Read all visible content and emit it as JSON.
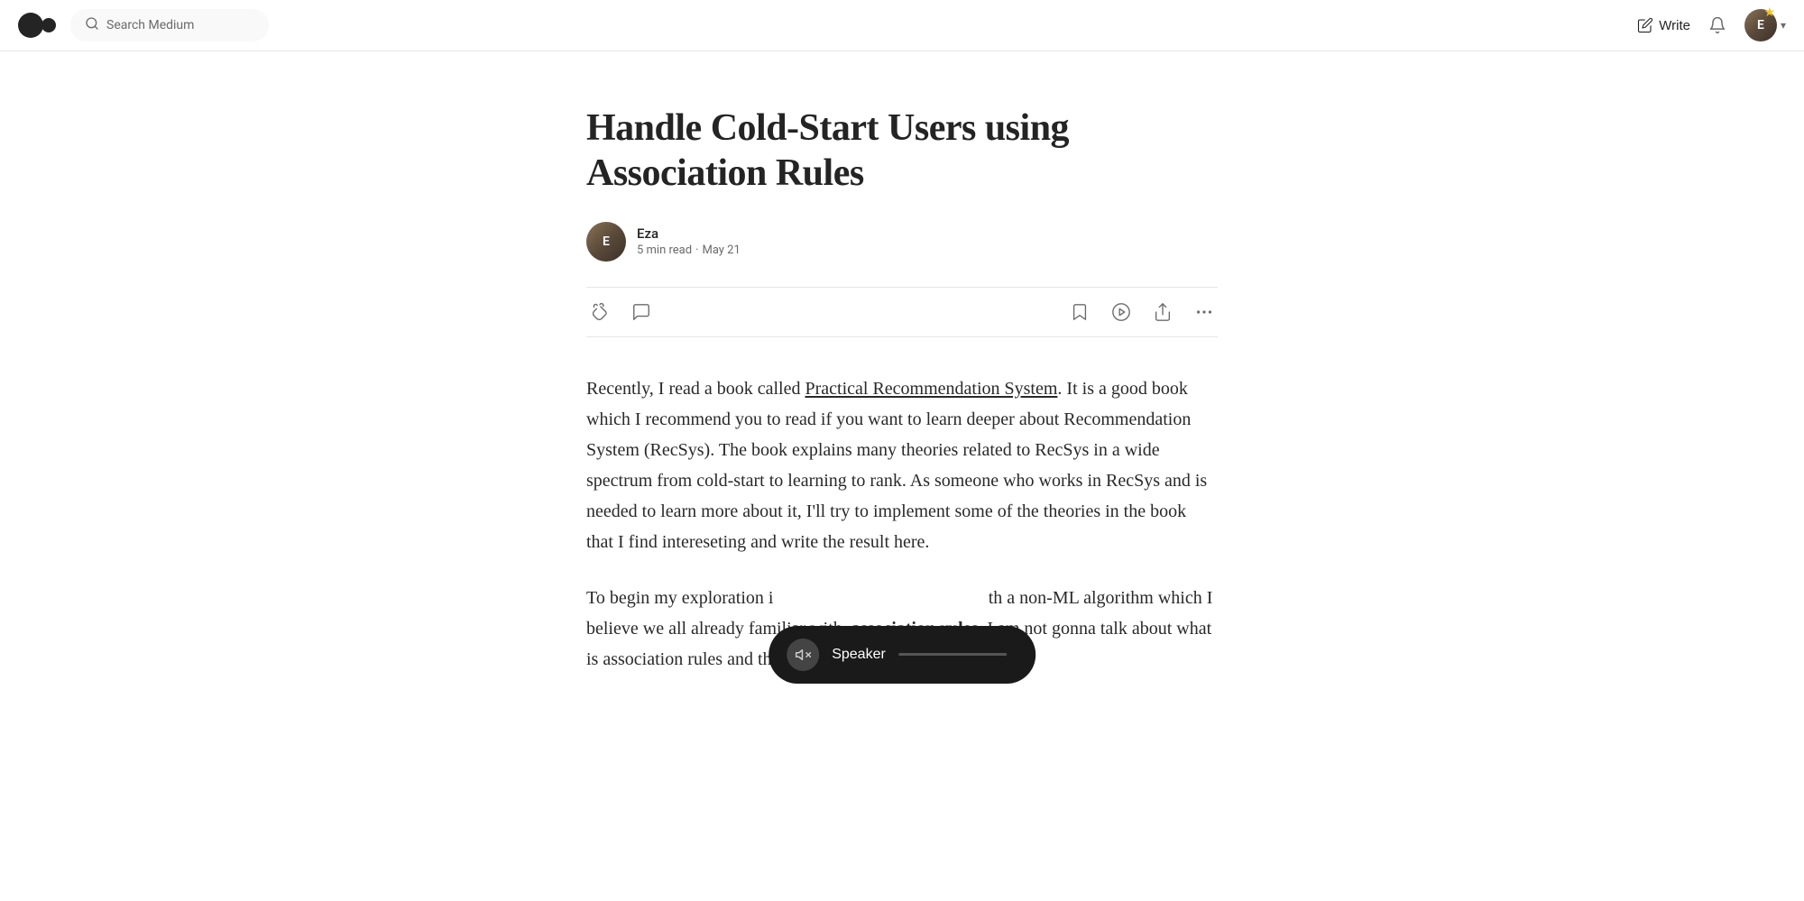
{
  "nav": {
    "search_placeholder": "Search Medium",
    "write_label": "Write",
    "logo_alt": "Medium logo"
  },
  "article": {
    "title": "Handle Cold-Start Users using Association Rules",
    "author": {
      "name": "Eza",
      "read_time": "5 min read",
      "date": "May 21"
    },
    "actions": {
      "clap_label": "Clap",
      "comment_label": "Comment",
      "bookmark_label": "Bookmark",
      "listen_label": "Listen",
      "share_label": "Share",
      "more_label": "More"
    },
    "body_para1": "Recently, I read a book called Practical Recommendation System. It is a good book which I recommend you to read if you want to learn deeper about Recommendation System (RecSys). The book explains many theories related to RecSys in a wide spectrum from cold-start to learning to rank. As someone who works in RecSys and is needed to learn more about it, I'll try to implement some of the theories in the book that I find intereseting and write the result here.",
    "body_para2_start": "To begin my exploration i",
    "body_para2_middle": "th a non-ML algorithm which I believe we all already familiar with,",
    "body_para2_bold": "association rules",
    "body_para2_end": ". I am not gonna talk about what is association rules and the algorithm behind it, you",
    "book_link_text": "Practical Recommendation System"
  },
  "speaker": {
    "label": "Speaker",
    "mute_icon": "🔇"
  }
}
